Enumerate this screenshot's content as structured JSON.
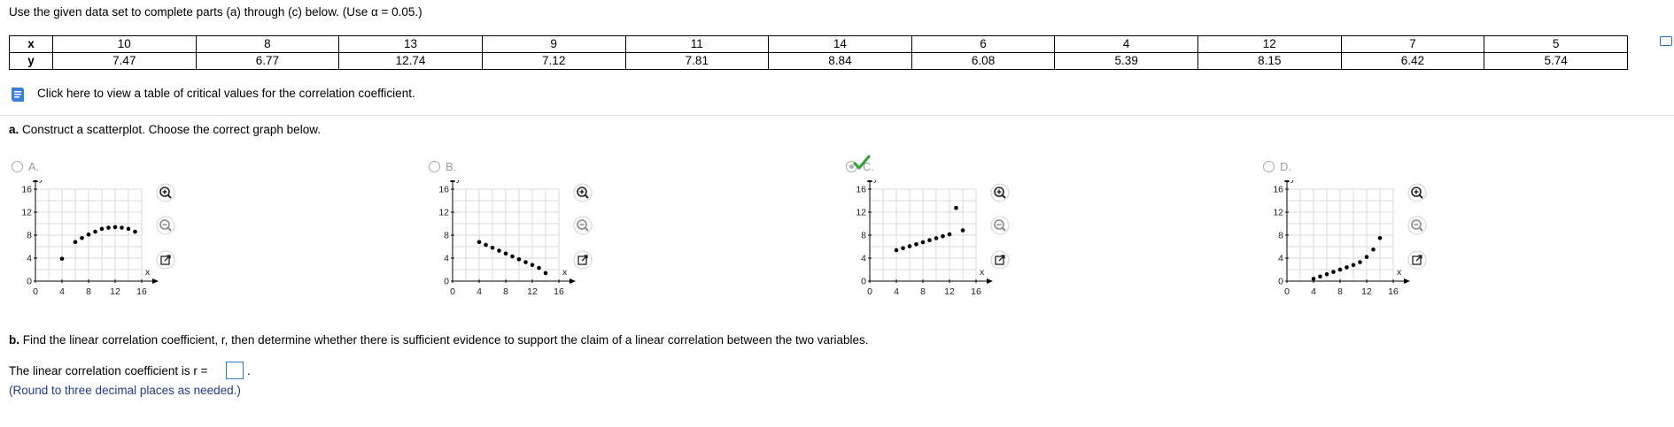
{
  "instructions": "Use the given data set to complete parts (a) through (c) below. (Use α = 0.05.)",
  "table": {
    "x_label": "x",
    "y_label": "y",
    "x": [
      "10",
      "8",
      "13",
      "9",
      "11",
      "14",
      "6",
      "4",
      "12",
      "7",
      "5"
    ],
    "y": [
      "7.47",
      "6.77",
      "12.74",
      "7.12",
      "7.81",
      "8.84",
      "6.08",
      "5.39",
      "8.15",
      "6.42",
      "5.74"
    ]
  },
  "critical_link": "Click here to view a table of critical values for the correlation coefficient.",
  "part_a": {
    "letter": "a.",
    "text": "Construct a scatterplot. Choose the correct graph below."
  },
  "options": [
    {
      "letter": "A.",
      "selected": false,
      "points": [
        [
          4,
          3.9
        ],
        [
          6,
          6.8
        ],
        [
          7,
          7.5
        ],
        [
          8,
          8.1
        ],
        [
          9,
          8.6
        ],
        [
          10,
          9.1
        ],
        [
          11,
          9.3
        ],
        [
          12,
          9.4
        ],
        [
          13,
          9.3
        ],
        [
          14,
          9.1
        ],
        [
          15,
          8.6
        ]
      ]
    },
    {
      "letter": "B.",
      "selected": false,
      "points": [
        [
          4,
          6.8
        ],
        [
          5,
          6.3
        ],
        [
          6,
          5.8
        ],
        [
          7,
          5.3
        ],
        [
          8,
          4.8
        ],
        [
          9,
          4.3
        ],
        [
          10,
          3.8
        ],
        [
          11,
          3.3
        ],
        [
          12,
          2.8
        ],
        [
          13,
          2.3
        ],
        [
          14,
          1.4
        ]
      ]
    },
    {
      "letter": "C.",
      "selected": true,
      "points": [
        [
          4,
          5.39
        ],
        [
          5,
          5.74
        ],
        [
          6,
          6.08
        ],
        [
          7,
          6.42
        ],
        [
          8,
          6.77
        ],
        [
          9,
          7.12
        ],
        [
          10,
          7.47
        ],
        [
          11,
          7.81
        ],
        [
          12,
          8.15
        ],
        [
          13,
          12.74
        ],
        [
          14,
          8.84
        ]
      ]
    },
    {
      "letter": "D.",
      "selected": false,
      "points": [
        [
          4,
          0.4
        ],
        [
          5,
          0.8
        ],
        [
          6,
          1.2
        ],
        [
          7,
          1.6
        ],
        [
          8,
          2.0
        ],
        [
          9,
          2.4
        ],
        [
          10,
          2.8
        ],
        [
          11,
          3.3
        ],
        [
          12,
          4.2
        ],
        [
          13,
          5.5
        ],
        [
          14,
          7.5
        ]
      ]
    }
  ],
  "axes": {
    "xlabel": "x",
    "ylabel": "y",
    "xticks": [
      "0",
      "4",
      "8",
      "12",
      "16"
    ],
    "yticks": [
      "0",
      "4",
      "8",
      "12",
      "16"
    ],
    "xlim": [
      0,
      16
    ],
    "ylim": [
      0,
      16
    ]
  },
  "icons": {
    "zoom_in": "zoom-in-icon",
    "zoom_out": "zoom-out-icon",
    "open": "open-window-icon",
    "book": "book-icon",
    "check": "checkmark-icon"
  },
  "part_b": {
    "letter": "b.",
    "text": "Find the linear correlation coefficient, r, then determine whether there is sufficient evidence to support the claim of a linear correlation between the two variables."
  },
  "r_label": "The linear correlation coefficient is r =",
  "r_value": "",
  "r_dot": ".",
  "round_note": "(Round to three decimal places as needed.)",
  "colors": {
    "link_blue": "#1f3c8f",
    "check_green": "#3aa23a",
    "input_border": "#2b7bd0"
  }
}
